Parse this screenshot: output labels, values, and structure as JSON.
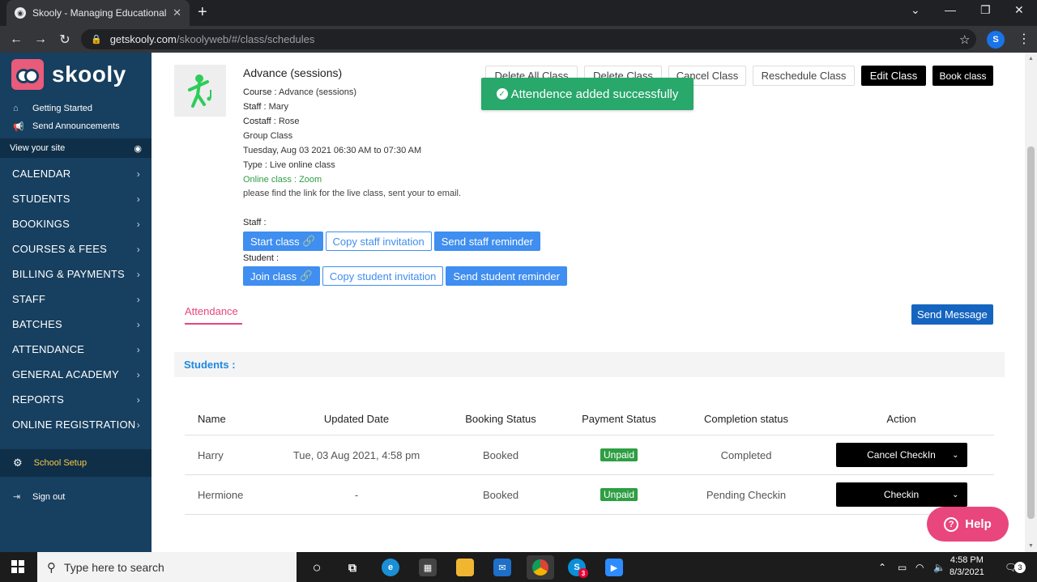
{
  "browser": {
    "tab_title": "Skooly - Managing Educational J",
    "url_host": "getskooly.com",
    "url_path": "/skoolyweb/#/class/schedules",
    "profile_initial": "S"
  },
  "sidebar": {
    "logo_text": "skooly",
    "top_links": [
      "Getting Started",
      "Send Announcements"
    ],
    "view_site": "View your site",
    "menu": [
      "CALENDAR",
      "STUDENTS",
      "BOOKINGS",
      "COURSES & FEES",
      "BILLING & PAYMENTS",
      "STAFF",
      "BATCHES",
      "ATTENDANCE",
      "GENERAL ACADEMY",
      "REPORTS",
      "ONLINE REGISTRATION"
    ],
    "school_setup": "School Setup",
    "sign_out": "Sign out"
  },
  "class": {
    "title": "Advance (sessions)",
    "course_label": "Course :",
    "course_value": "Advance (sessions)",
    "staff_label": "Staff :",
    "staff_value": "Mary",
    "costaff_label": "Costaff :",
    "costaff_value": "Rose",
    "group": "Group Class",
    "datetime": "Tuesday, Aug 03 2021 06:30 AM to 07:30 AM",
    "type": "Type : Live online class",
    "online": "Online class : Zoom",
    "desc": "please find the link for the live class, sent your to email.",
    "staff_row_label": "Staff :",
    "student_row_label": "Student :",
    "start_class": "Start class",
    "copy_staff": "Copy staff invitation",
    "send_staff": "Send staff reminder",
    "join_class": "Join class",
    "copy_student": "Copy student invitation",
    "send_student": "Send student reminder"
  },
  "top_buttons": {
    "delete_all": "Delete All Class",
    "delete": "Delete Class",
    "cancel": "Cancel Class",
    "reschedule": "Reschedule Class",
    "edit": "Edit Class",
    "book": "Book class"
  },
  "toast": "Attendence added successfully",
  "attendance_tab": "Attendance",
  "send_message": "Send Message",
  "students_heading": "Students :",
  "table": {
    "headers": [
      "Name",
      "Updated Date",
      "Booking Status",
      "Payment Status",
      "Completion status",
      "Action"
    ],
    "rows": [
      {
        "name": "Harry",
        "updated": "Tue, 03 Aug 2021, 4:58 pm",
        "booking": "Booked",
        "payment": "Unpaid",
        "completion": "Completed",
        "action": "Cancel CheckIn"
      },
      {
        "name": "Hermione",
        "updated": "-",
        "booking": "Booked",
        "payment": "Unpaid",
        "completion": "Pending Checkin",
        "action": "Checkin"
      }
    ]
  },
  "help": "Help",
  "taskbar": {
    "search_placeholder": "Type here to search",
    "time": "4:58 PM",
    "date": "8/3/2021",
    "skype_badge": "3",
    "notif_count": "3"
  },
  "colors": {
    "sidebar": "#173f5f",
    "primary": "#3f8ef0",
    "accent": "#e8467c",
    "success": "#28a86b"
  }
}
